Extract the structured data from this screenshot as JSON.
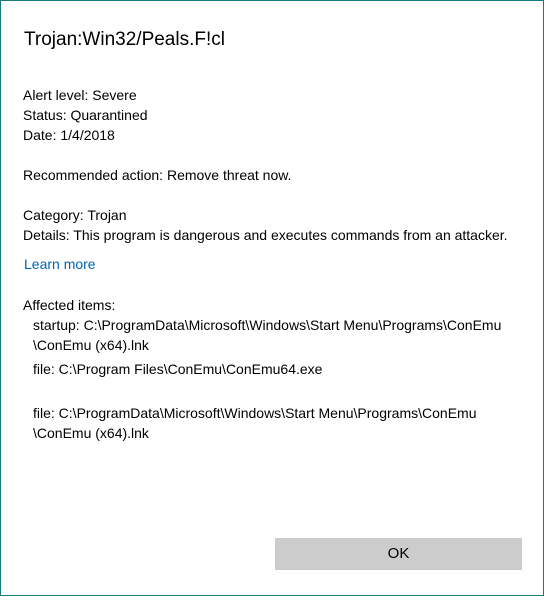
{
  "threat": {
    "name": "Trojan:Win32/Peals.F!cl",
    "alert_level": "Alert level: Severe",
    "status": "Status: Quarantined",
    "date": "Date: 1/4/2018",
    "recommended_action": "Recommended action: Remove threat now.",
    "category": "Category: Trojan",
    "details": "Details: This program is dangerous and executes commands from an attacker."
  },
  "learn_more_label": "Learn more",
  "affected": {
    "heading": "Affected items:",
    "items": [
      {
        "line1": "startup: C:\\ProgramData\\Microsoft\\Windows\\Start Menu\\Programs\\ConEmu",
        "line2": "\\ConEmu (x64).lnk"
      },
      {
        "line1": "file: C:\\Program Files\\ConEmu\\ConEmu64.exe"
      },
      {
        "line1": "file: C:\\ProgramData\\Microsoft\\Windows\\Start Menu\\Programs\\ConEmu",
        "line2": "\\ConEmu (x64).lnk"
      }
    ]
  },
  "ok_label": "OK",
  "colors": {
    "link": "#0063b1",
    "border": "#1b7a7a",
    "button_bg": "#cccccc"
  }
}
